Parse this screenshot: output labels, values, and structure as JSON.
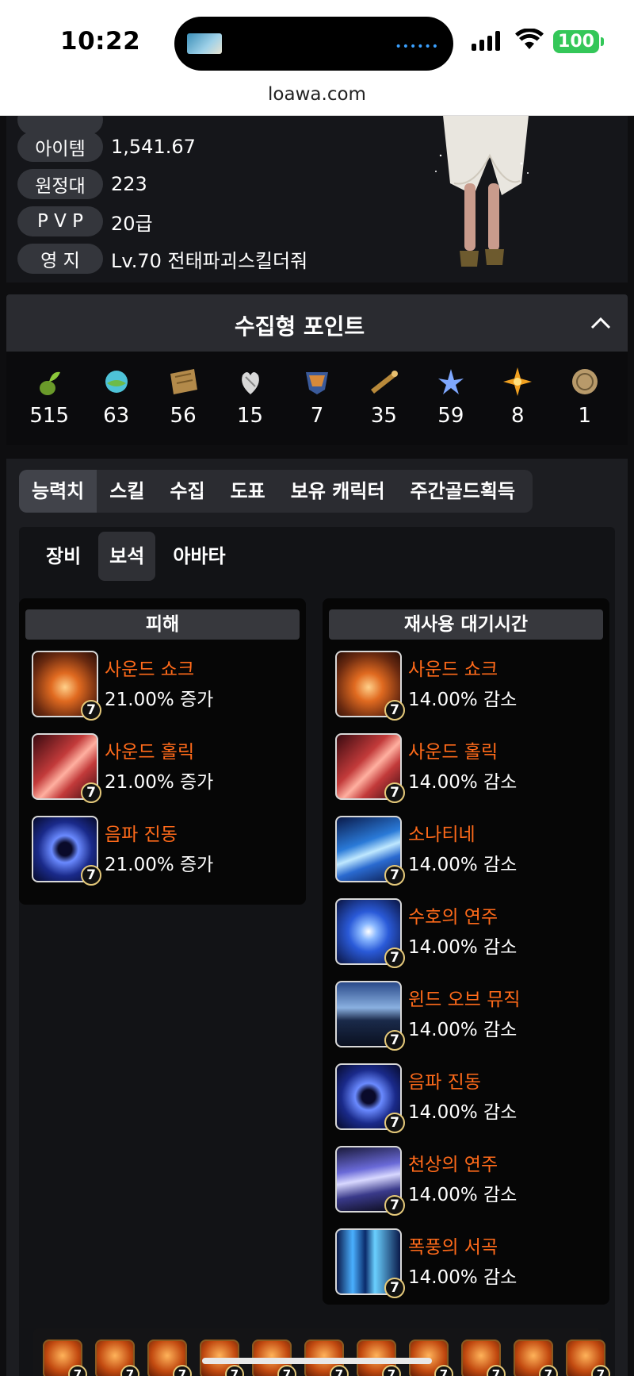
{
  "status": {
    "time": "10:22",
    "battery": "100"
  },
  "browser": {
    "url": "loawa.com"
  },
  "profile": {
    "rows": [
      {
        "label": "아이템",
        "value": "1,541.67"
      },
      {
        "label": "원정대",
        "value": "223"
      },
      {
        "label": "P V P",
        "value": "20급"
      },
      {
        "label": "영 지",
        "value": "Lv.70 전태파괴스킬더줘"
      }
    ]
  },
  "collect": {
    "title": "수집형 포인트",
    "items": [
      {
        "icon": "seed-icon",
        "count": "515"
      },
      {
        "icon": "island-orb-icon",
        "count": "63"
      },
      {
        "icon": "map-icon",
        "count": "56"
      },
      {
        "icon": "heart-icon",
        "count": "15"
      },
      {
        "icon": "mask-icon",
        "count": "7"
      },
      {
        "icon": "telescope-icon",
        "count": "35"
      },
      {
        "icon": "leaf-icon",
        "count": "59"
      },
      {
        "icon": "star-icon",
        "count": "8"
      },
      {
        "icon": "coin-icon",
        "count": "1"
      }
    ]
  },
  "tabs": [
    "능력치",
    "스킬",
    "수집",
    "도표",
    "보유 캐릭터",
    "주간골드획득"
  ],
  "subtabs": [
    "장비",
    "보석",
    "아바타"
  ],
  "damage": {
    "title": "피해",
    "gems": [
      {
        "name": "사운드 쇼크",
        "effect": "21.00% 증가",
        "level": "7",
        "icon": "sound-shock-icon"
      },
      {
        "name": "사운드 홀릭",
        "effect": "21.00% 증가",
        "level": "7",
        "icon": "sound-holic-icon"
      },
      {
        "name": "음파 진동",
        "effect": "21.00% 증가",
        "level": "7",
        "icon": "sonic-vibration-icon"
      }
    ]
  },
  "cooldown": {
    "title": "재사용 대기시간",
    "gems": [
      {
        "name": "사운드 쇼크",
        "effect": "14.00% 감소",
        "level": "7",
        "icon": "sound-shock-icon"
      },
      {
        "name": "사운드 홀릭",
        "effect": "14.00% 감소",
        "level": "7",
        "icon": "sound-holic-icon"
      },
      {
        "name": "소나티네",
        "effect": "14.00% 감소",
        "level": "7",
        "icon": "sonatina-icon"
      },
      {
        "name": "수호의 연주",
        "effect": "14.00% 감소",
        "level": "7",
        "icon": "guardian-tune-icon"
      },
      {
        "name": "윈드 오브 뮤직",
        "effect": "14.00% 감소",
        "level": "7",
        "icon": "wind-of-music-icon"
      },
      {
        "name": "음파 진동",
        "effect": "14.00% 감소",
        "level": "7",
        "icon": "sonic-vibration-icon"
      },
      {
        "name": "천상의 연주",
        "effect": "14.00% 감소",
        "level": "7",
        "icon": "heavenly-tune-icon"
      },
      {
        "name": "폭풍의 서곡",
        "effect": "14.00% 감소",
        "level": "7",
        "icon": "prelude-of-storm-icon"
      }
    ]
  },
  "bottom_gems": {
    "level": "7",
    "count": 11
  }
}
